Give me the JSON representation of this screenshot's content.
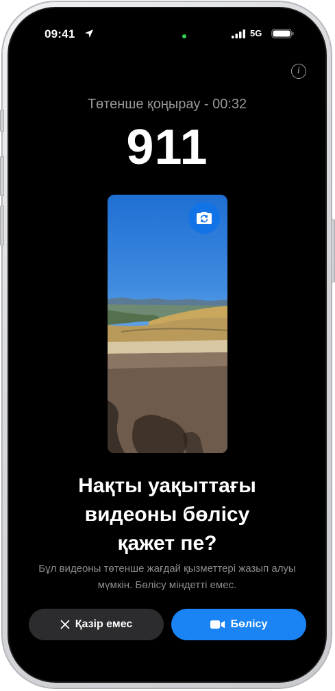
{
  "status_bar": {
    "time": "09:41",
    "location_icon": "location-arrow-icon",
    "network": "5G",
    "signal_icon": "cellular-signal-icon",
    "battery_icon": "battery-icon",
    "camera_indicator_color": "#30d158"
  },
  "header": {
    "info_icon": "info-icon",
    "info_glyph": "i"
  },
  "call": {
    "status": "Төтенше қоңырау - 00:32",
    "number": "911"
  },
  "video": {
    "flip_camera_icon": "flip-camera-icon"
  },
  "prompt": {
    "title_lines": [
      "Нақты уақыттағы",
      "видеоны бөлісу",
      "қажет пе?"
    ],
    "body": "Бұл видеоны төтенше жағдай қызметтері жазып алуы мүмкін. Бөлісу міндетті емес."
  },
  "actions": {
    "decline_label": "Қазір емес",
    "decline_icon": "close-x-icon",
    "share_label": "Бөлісу",
    "share_icon": "video-camera-icon"
  },
  "colors": {
    "accent": "#1a84f5",
    "background": "#000000",
    "secondary_button": "#2c2c2e",
    "secondary_text": "#8e8e93"
  }
}
